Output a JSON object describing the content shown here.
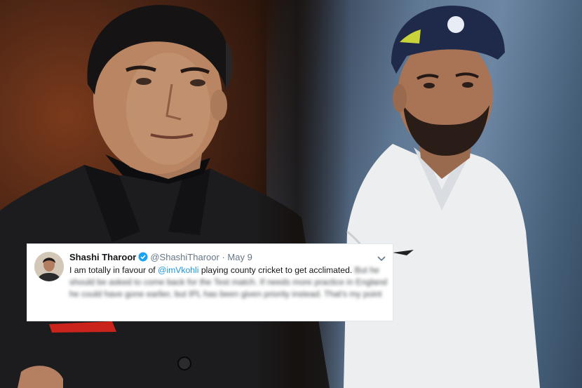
{
  "tweet": {
    "name": "Shashi Tharoor",
    "handle": "@ShashiTharoor",
    "separator": "·",
    "date": "May 9",
    "text_start": "I am totally in favour of ",
    "mention": "@imVkohli",
    "text_clear_end": " playing county cricket to get acclimated.",
    "text_blurred": " But he should be asked to come back for the Test match. If needs more practice in England he could have gone earlier, but IPL has been given priority instead. That's my point"
  },
  "colors": {
    "mention": "#1b95e0",
    "verified": "#1da1f2",
    "muted": "#657786"
  },
  "icons": [
    "verified-badge-icon",
    "chevron-down-icon"
  ]
}
